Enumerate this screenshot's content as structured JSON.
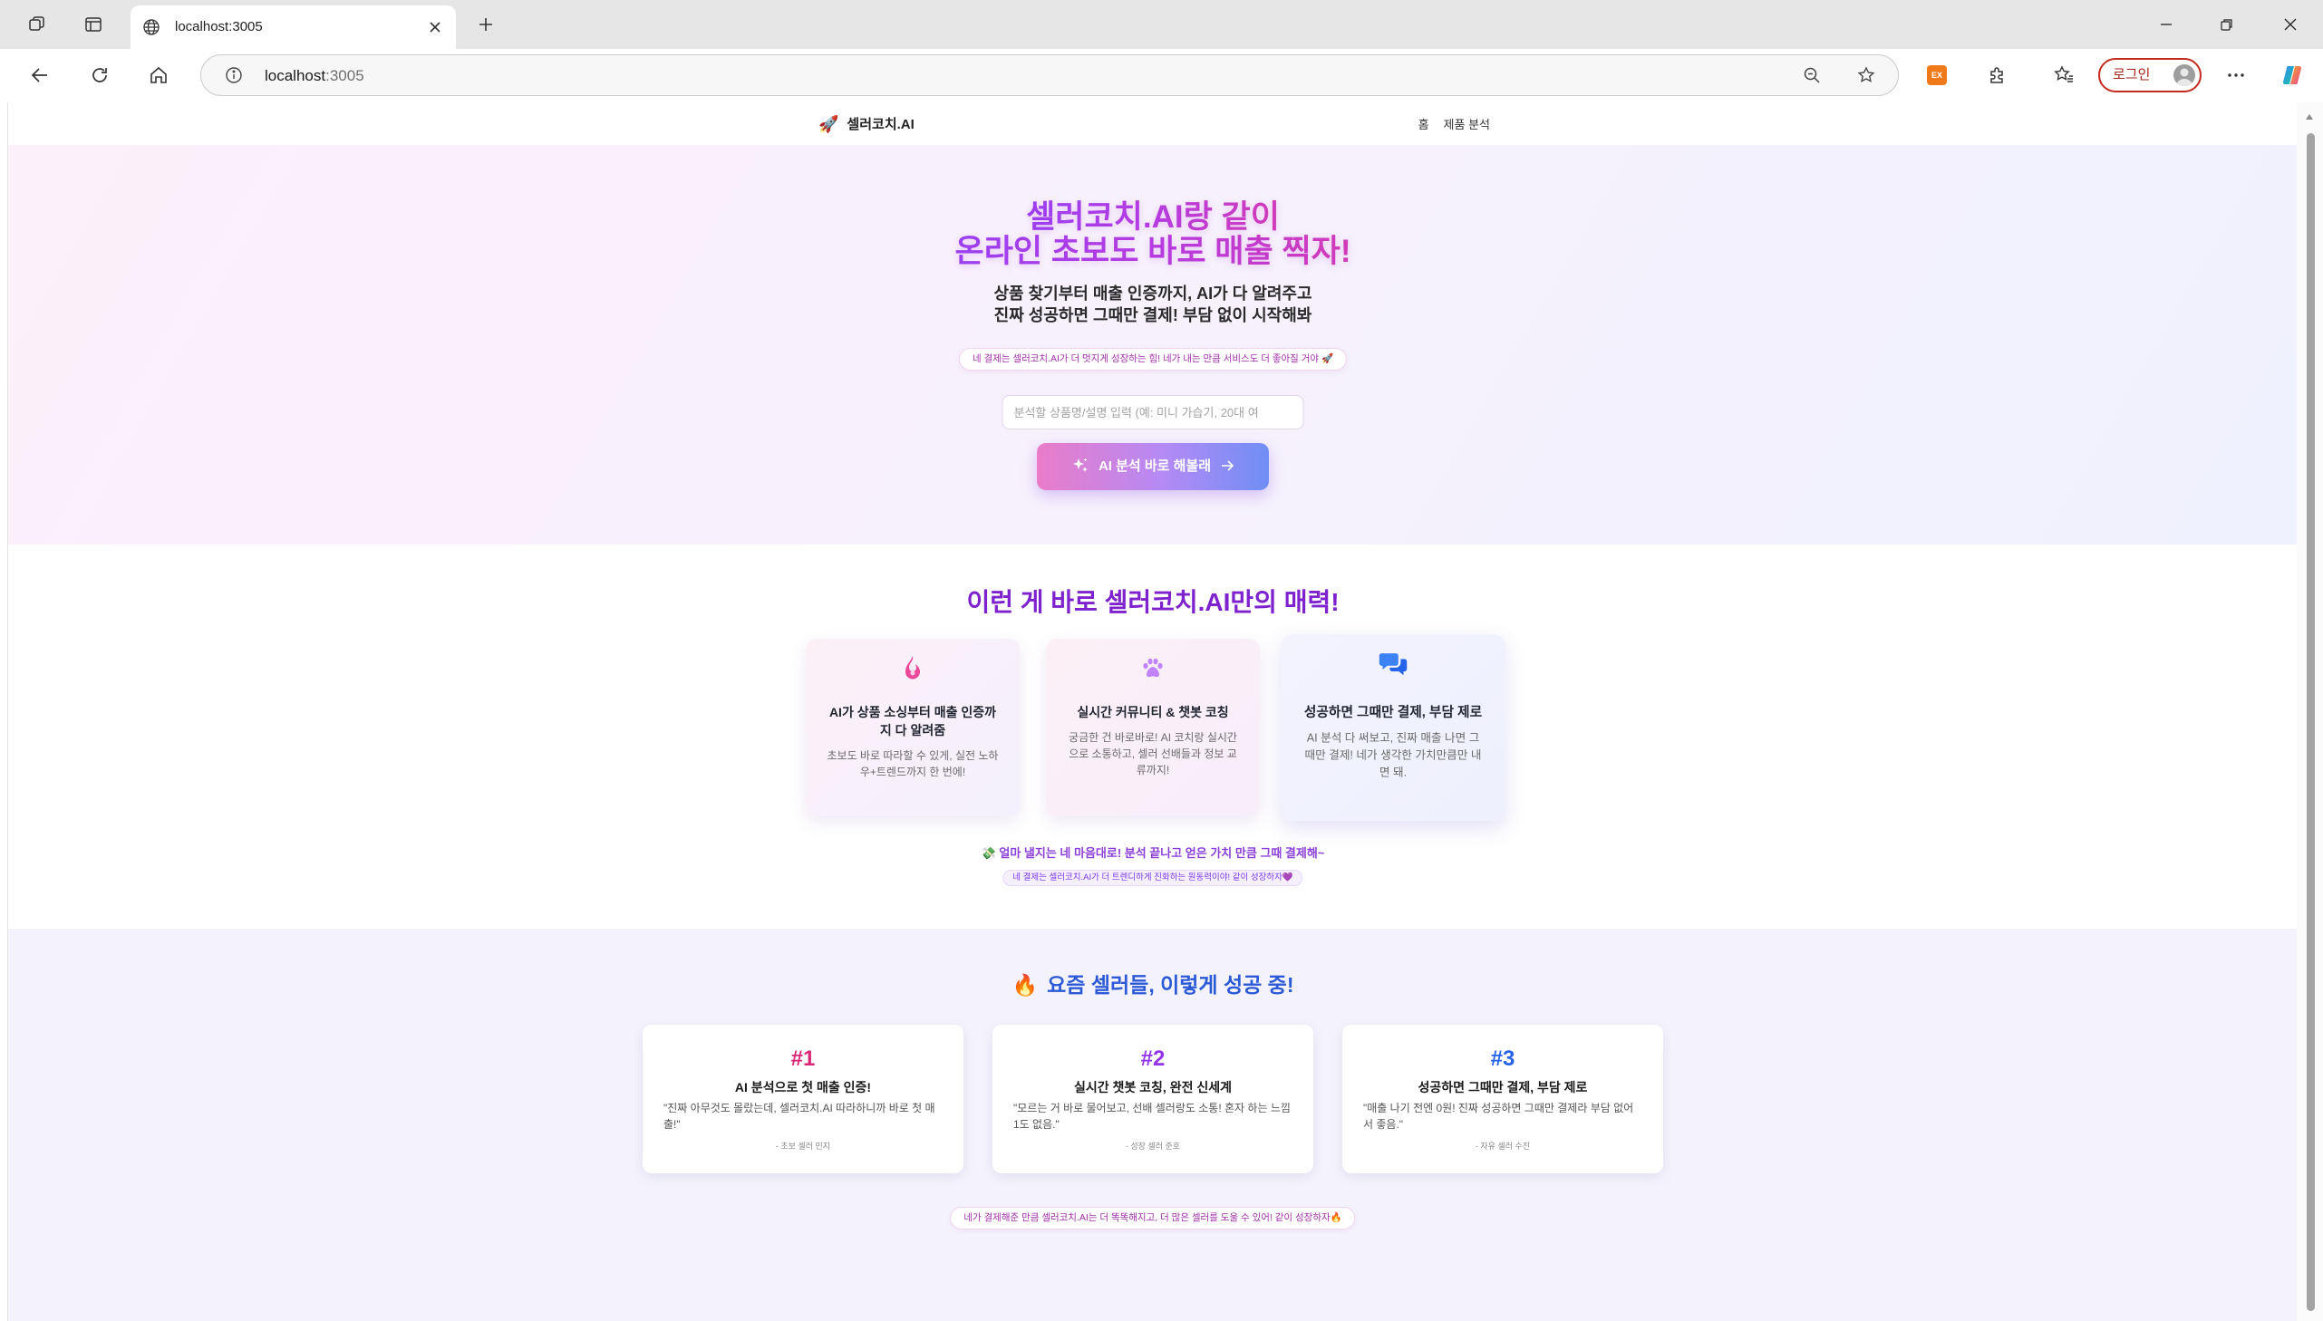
{
  "browser": {
    "tab_title": "localhost:3005",
    "url_host": "localhost",
    "url_port": ":3005",
    "ex_badge": "EX",
    "profile_label": "로그인"
  },
  "nav": {
    "logo_emoji": "🚀",
    "logo_text": "셀러코치.AI",
    "links": [
      "홈",
      "제품 분석"
    ]
  },
  "hero": {
    "title_line1": "셀러코치.AI랑 같이",
    "title_line2": "온라인 초보도 바로 매출 찍자!",
    "subtitle_line1": "상품 찾기부터 매출 인증까지, AI가 다 알려주고",
    "subtitle_line2": "진짜 성공하면 그때만 결제! 부담 없이 시작해봐",
    "pill": "네 결제는 셀러코치.AI가 더 멋지게 성장하는 힘! 네가 내는 만큼 서비스도 더 좋아질 거야 🚀",
    "input_placeholder": "분석할 상품명/설명 입력 (예: 미니 가습기, 20대 여",
    "cta_label": "AI 분석 바로 해볼래"
  },
  "features": {
    "heading": "이런 게 바로 셀러코치.AI만의 매력!",
    "cards": [
      {
        "icon": "flame-icon",
        "title": "AI가 상품 소싱부터 매출 인증까지 다 알려줌",
        "desc": "초보도 바로 따라할 수 있게, 실전 노하우+트렌드까지 한 번에!"
      },
      {
        "icon": "paw-icon",
        "title": "실시간 커뮤니티 & 챗봇 코칭",
        "desc": "궁금한 건 바로바로! AI 코치랑 실시간으로 소통하고, 셀러 선배들과 정보 교류까지!"
      },
      {
        "icon": "chat-bubbles-icon",
        "title": "성공하면 그때만 결제, 부담 제로",
        "desc": "AI 분석 다 써보고, 진짜 매출 나면 그때만 결제! 네가 생각한 가치만큼만 내면 돼."
      }
    ],
    "note": "💸 얼마 낼지는 네 마음대로! 분석 끝나고 얻은 가치 만큼 그때 결제해~",
    "pill": "네 결제는 셀러코치.AI가 더 트렌디하게 진화하는 원동력이야! 같이 성장하자💜"
  },
  "success": {
    "heading_emoji": "🔥",
    "heading": "요즘 셀러들, 이렇게 성공 중!",
    "stories": [
      {
        "rank": "#1",
        "rank_color": "#db2777",
        "title": "AI 분석으로 첫 매출 인증!",
        "quote": "\"진짜 아무것도 몰랐는데, 셀러코치.AI 따라하니까 바로 첫 매출!\"",
        "author": "- 초보 셀러 민지"
      },
      {
        "rank": "#2",
        "rank_color": "#9333ea",
        "title": "실시간 챗봇 코칭, 완전 신세계",
        "quote": "\"모르는 거 바로 물어보고, 선배 셀러랑도 소통! 혼자 하는 느낌 1도 없음.\"",
        "author": "- 성장 셀러 준호"
      },
      {
        "rank": "#3",
        "rank_color": "#2563eb",
        "title": "성공하면 그때만 결제, 부담 제로",
        "quote": "\"매출 나기 전엔 0원! 진짜 성공하면 그때만 결제라 부담 없어서 좋음.\"",
        "author": "- 자유 셀러 수진"
      }
    ],
    "pill": "네가 결제해준 만큼 셀러코치.AI는 더 똑똑해지고, 더 많은 셀러를 도울 수 있어! 같이 성장하자🔥"
  },
  "theme": {
    "primary_purple": "#7e22ce",
    "pink": "#ec4899",
    "blue": "#2563eb",
    "profile_border": "#c42b1c"
  }
}
